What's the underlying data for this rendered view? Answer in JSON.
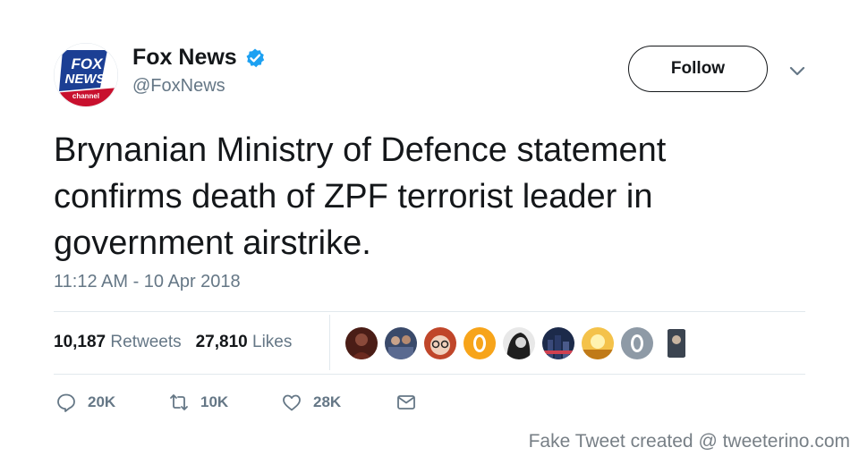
{
  "header": {
    "logo_text_top": "FOX",
    "logo_text_mid": "NEWS",
    "logo_text_bot": "channel",
    "display_name": "Fox News",
    "handle": "@FoxNews",
    "follow_label": "Follow"
  },
  "tweet": {
    "text": "Brynanian Ministry of Defence statement confirms death of ZPF terrorist leader in government airstrike.",
    "timestamp": "11:12 AM - 10 Apr 2018"
  },
  "stats": {
    "retweets_count": "10,187",
    "retweets_label": "Retweets",
    "likes_count": "27,810",
    "likes_label": "Likes"
  },
  "likers": [
    {
      "name": "liker-1-avatar",
      "icon": "person-photo",
      "color": "#6b2a1f"
    },
    {
      "name": "liker-2-avatar",
      "icon": "group-photo",
      "color": "#3a4a6a"
    },
    {
      "name": "liker-3-avatar",
      "icon": "person-glasses-photo",
      "color": "#c0462a"
    },
    {
      "name": "liker-4-avatar",
      "icon": "orange-ring",
      "color": "#f7a41a"
    },
    {
      "name": "liker-5-avatar",
      "icon": "person-bw-photo",
      "color": "#2d2d2d"
    },
    {
      "name": "liker-6-avatar",
      "icon": "city-night-photo",
      "color": "#1c2a4a"
    },
    {
      "name": "liker-7-avatar",
      "icon": "sunset-photo",
      "color": "#f0b020"
    },
    {
      "name": "liker-8-avatar",
      "icon": "grey-ring",
      "color": "#8e9aa6"
    },
    {
      "name": "liker-9-avatar",
      "icon": "person-dark-photo",
      "color": "#3b4450"
    }
  ],
  "actions": {
    "reply_count": "20K",
    "retweet_count": "10K",
    "like_count": "28K"
  },
  "footer": {
    "text": "Fake Tweet created @ tweeterino.com"
  },
  "colors": {
    "text": "#14171a",
    "secondary": "#657786",
    "verified_blue": "#1da1f2",
    "fox_blue": "#1c3f94",
    "fox_red": "#c8102e"
  }
}
